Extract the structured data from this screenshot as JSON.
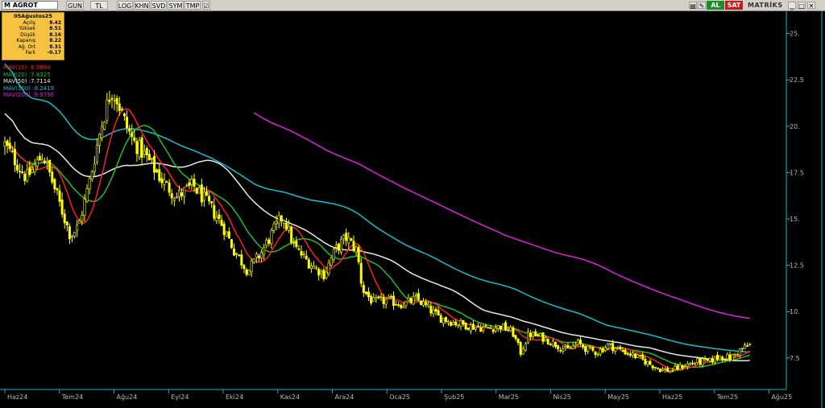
{
  "toolbar": {
    "symbol_prefix": "M",
    "symbol": "AGROT",
    "buttons": [
      "GUN",
      "TL",
      "LOG",
      "KHN",
      "SVD",
      "SYM",
      "TMP"
    ],
    "buy_label": "AL",
    "sell_label": "SAT",
    "brand": "MATRİKS"
  },
  "info_panel": {
    "date": "05Ağustos25",
    "rows": [
      {
        "label": "Açılış",
        "value": "8.42"
      },
      {
        "label": "Yüksek",
        "value": "8.51"
      },
      {
        "label": "Düşük",
        "value": "8.16"
      },
      {
        "label": "Kapanış",
        "value": "8.22"
      },
      {
        "label": "Ağ. Ort",
        "value": "8.31"
      },
      {
        "label": "Fark",
        "value": "-0.17"
      }
    ]
  },
  "colors": {
    "candle": "#ffff00",
    "mav10": "#ff2020",
    "mav20": "#20c020",
    "mav50": "#e8e8e8",
    "mav100": "#10c0d0",
    "mav200": "#e020e0",
    "axis": "#00bcd4"
  },
  "chart_data": {
    "type": "candlestick",
    "x_ticks": [
      "Haz24",
      "Tem24",
      "Ağu24",
      "Eyl24",
      "Eki24",
      "Kas24",
      "Ara24",
      "Oca25",
      "Şub25",
      "Mar25",
      "Nis25",
      "May25",
      "Haz25",
      "Tem25",
      "Ağu25"
    ],
    "y_ticks": [
      "25.",
      "22.5",
      "20.",
      "17.5",
      "15.",
      "12.5",
      "10.",
      "7.5"
    ],
    "ylim": [
      5.8,
      26.2
    ],
    "months_shown": 14.2,
    "price_path": [
      [
        0.0,
        19.0
      ],
      [
        0.4,
        17.2
      ],
      [
        0.7,
        18.5
      ],
      [
        0.95,
        16.3
      ],
      [
        1.2,
        14.1
      ],
      [
        1.35,
        14.6
      ],
      [
        1.55,
        17.0
      ],
      [
        1.75,
        19.8
      ],
      [
        1.95,
        22.0
      ],
      [
        2.05,
        21.5
      ],
      [
        2.2,
        20.2
      ],
      [
        2.35,
        19.2
      ],
      [
        2.6,
        18.3
      ],
      [
        2.9,
        17.0
      ],
      [
        3.15,
        16.2
      ],
      [
        3.45,
        16.8
      ],
      [
        3.75,
        15.7
      ],
      [
        4.0,
        14.6
      ],
      [
        4.2,
        13.3
      ],
      [
        4.45,
        12.2
      ],
      [
        4.7,
        13.2
      ],
      [
        4.95,
        14.5
      ],
      [
        5.1,
        15.2
      ],
      [
        5.3,
        13.5
      ],
      [
        5.55,
        12.7
      ],
      [
        5.85,
        12.0
      ],
      [
        6.05,
        13.3
      ],
      [
        6.25,
        14.0
      ],
      [
        6.45,
        13.3
      ],
      [
        6.55,
        11.2
      ],
      [
        6.75,
        10.5
      ],
      [
        7.0,
        10.6
      ],
      [
        7.3,
        10.4
      ],
      [
        7.55,
        10.7
      ],
      [
        7.75,
        10.2
      ],
      [
        7.95,
        9.7
      ],
      [
        8.25,
        9.4
      ],
      [
        8.55,
        9.2
      ],
      [
        8.85,
        9.1
      ],
      [
        9.1,
        9.2
      ],
      [
        9.3,
        8.9
      ],
      [
        9.45,
        7.8
      ],
      [
        9.6,
        8.8
      ],
      [
        9.85,
        8.6
      ],
      [
        10.05,
        8.3
      ],
      [
        10.3,
        7.9
      ],
      [
        10.5,
        8.3
      ],
      [
        10.65,
        8.0
      ],
      [
        10.85,
        7.8
      ],
      [
        11.05,
        8.2
      ],
      [
        11.3,
        7.9
      ],
      [
        11.55,
        7.6
      ],
      [
        11.8,
        7.2
      ],
      [
        12.0,
        6.9
      ],
      [
        12.2,
        6.8
      ],
      [
        12.45,
        7.1
      ],
      [
        12.7,
        7.3
      ],
      [
        12.9,
        7.3
      ],
      [
        13.1,
        7.6
      ],
      [
        13.3,
        7.5
      ],
      [
        13.5,
        8.0
      ],
      [
        13.65,
        8.2
      ]
    ],
    "mav_current": [
      {
        "name": "MAV(10)",
        "value": "8.0894"
      },
      {
        "name": "MAV(20)",
        "value": "7.8325"
      },
      {
        "name": "MAV(50)",
        "value": "7.7114"
      },
      {
        "name": "MAV(100)",
        "value": "8.2419"
      },
      {
        "name": "MAV(200)",
        "value": "9.9736"
      }
    ]
  }
}
